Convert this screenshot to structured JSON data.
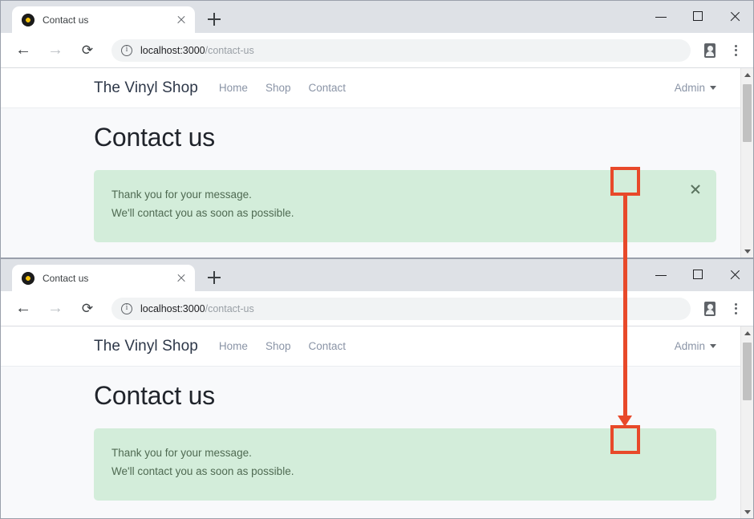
{
  "browser": {
    "tab": {
      "title": "Contact us",
      "favicon_icon": "vinyl-record-icon",
      "close_icon": "close-icon"
    },
    "new_tab_icon": "plus-icon",
    "window_controls": {
      "minimize_icon": "minimize-icon",
      "maximize_icon": "maximize-icon",
      "close_icon": "window-close-icon"
    },
    "toolbar": {
      "back_icon": "arrow-left-icon",
      "forward_icon": "arrow-right-icon",
      "reload_icon": "reload-icon",
      "site_info_icon": "info-circle-icon",
      "url_host": "localhost:3000",
      "url_path": "/contact-us",
      "profile_icon": "profile-card-icon",
      "menu_icon": "kebab-menu-icon"
    },
    "scrollbar": {
      "up_arrow_icon": "scroll-up-arrow-icon",
      "down_arrow_icon": "scroll-down-arrow-icon"
    }
  },
  "site": {
    "brand": "The Vinyl Shop",
    "nav_links": [
      {
        "label": "Home"
      },
      {
        "label": "Shop"
      },
      {
        "label": "Contact"
      }
    ],
    "user_menu": {
      "label": "Admin",
      "caret_icon": "chevron-down-icon"
    },
    "page_title": "Contact us",
    "alert": {
      "line1": "Thank you for your message.",
      "line2": "We'll contact you as soon as possible.",
      "close_icon": "alert-close-icon",
      "background_color": "#d3edda",
      "text_color": "#4f6a52"
    }
  },
  "annotation": {
    "color": "#e8492a",
    "source_label": "alert-dismiss-button",
    "target_label": "alert-dismiss-button-after-click",
    "arrow_icon": "down-arrow-icon"
  },
  "states": {
    "before": {
      "alert_close_visible": true
    },
    "after": {
      "alert_close_visible": false
    }
  }
}
